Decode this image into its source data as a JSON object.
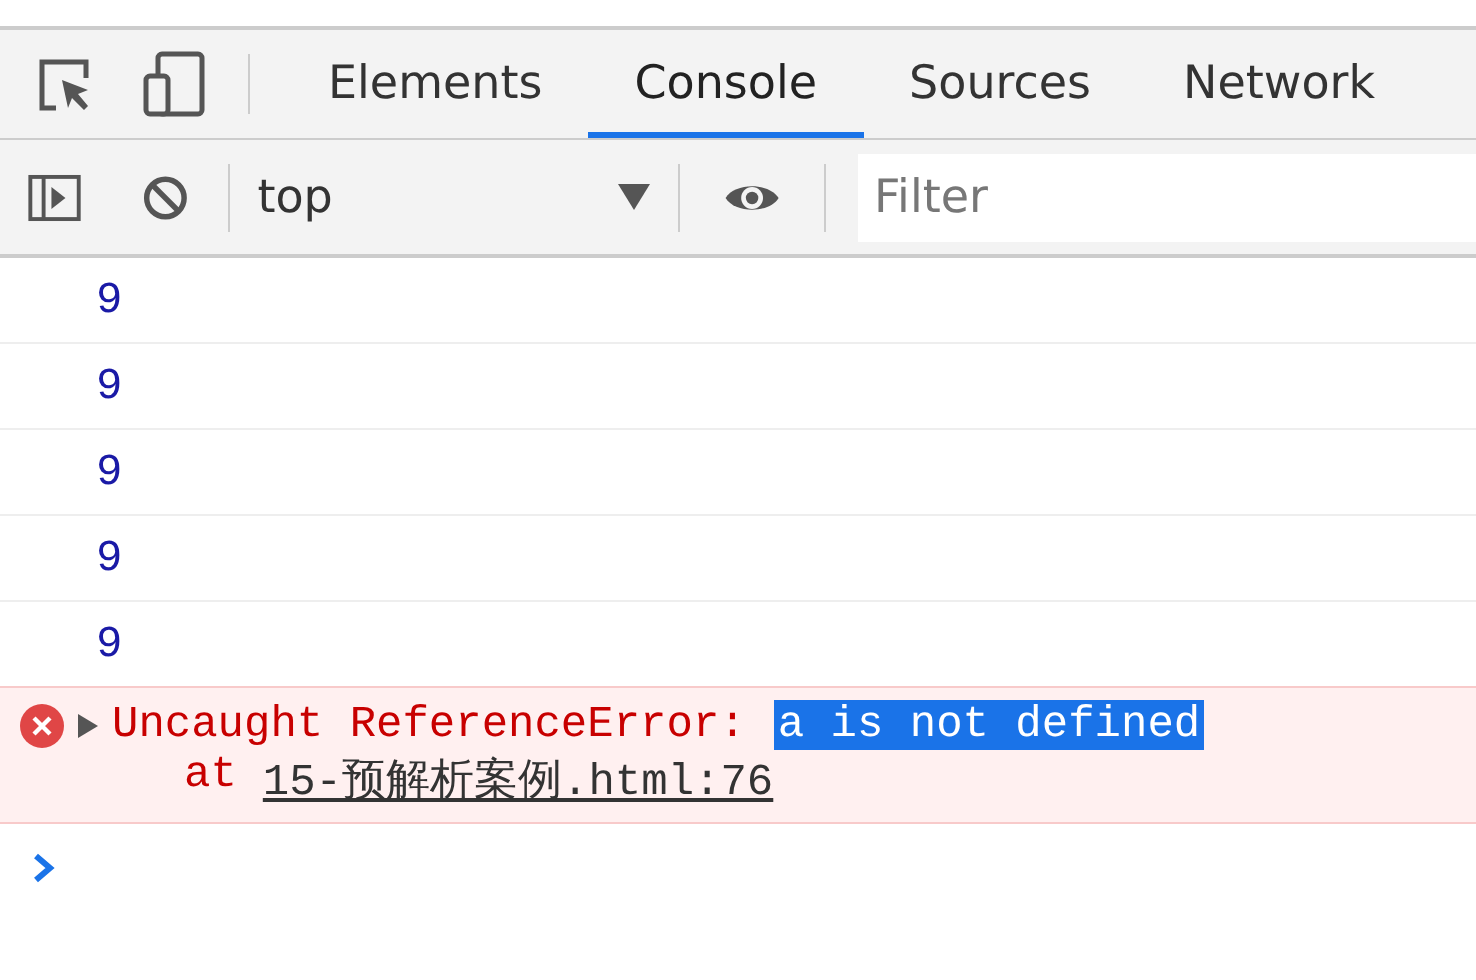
{
  "tabs": [
    {
      "label": "Elements",
      "selected": false
    },
    {
      "label": "Console",
      "selected": true
    },
    {
      "label": "Sources",
      "selected": false
    },
    {
      "label": "Network",
      "selected": false
    }
  ],
  "toolbar": {
    "context": "top",
    "filter": {
      "placeholder": "Filter"
    }
  },
  "messages": [
    {
      "kind": "log",
      "text": "9"
    },
    {
      "kind": "log",
      "text": "9"
    },
    {
      "kind": "log",
      "text": "9"
    },
    {
      "kind": "log",
      "text": "9"
    },
    {
      "kind": "log",
      "text": "9"
    },
    {
      "kind": "error",
      "expanded": false,
      "text": "Uncaught ReferenceError:",
      "detail": {
        "text": "a is not defined",
        "highlighted": true
      },
      "at": "at",
      "location": "15-预解析案例.html:76"
    }
  ]
}
